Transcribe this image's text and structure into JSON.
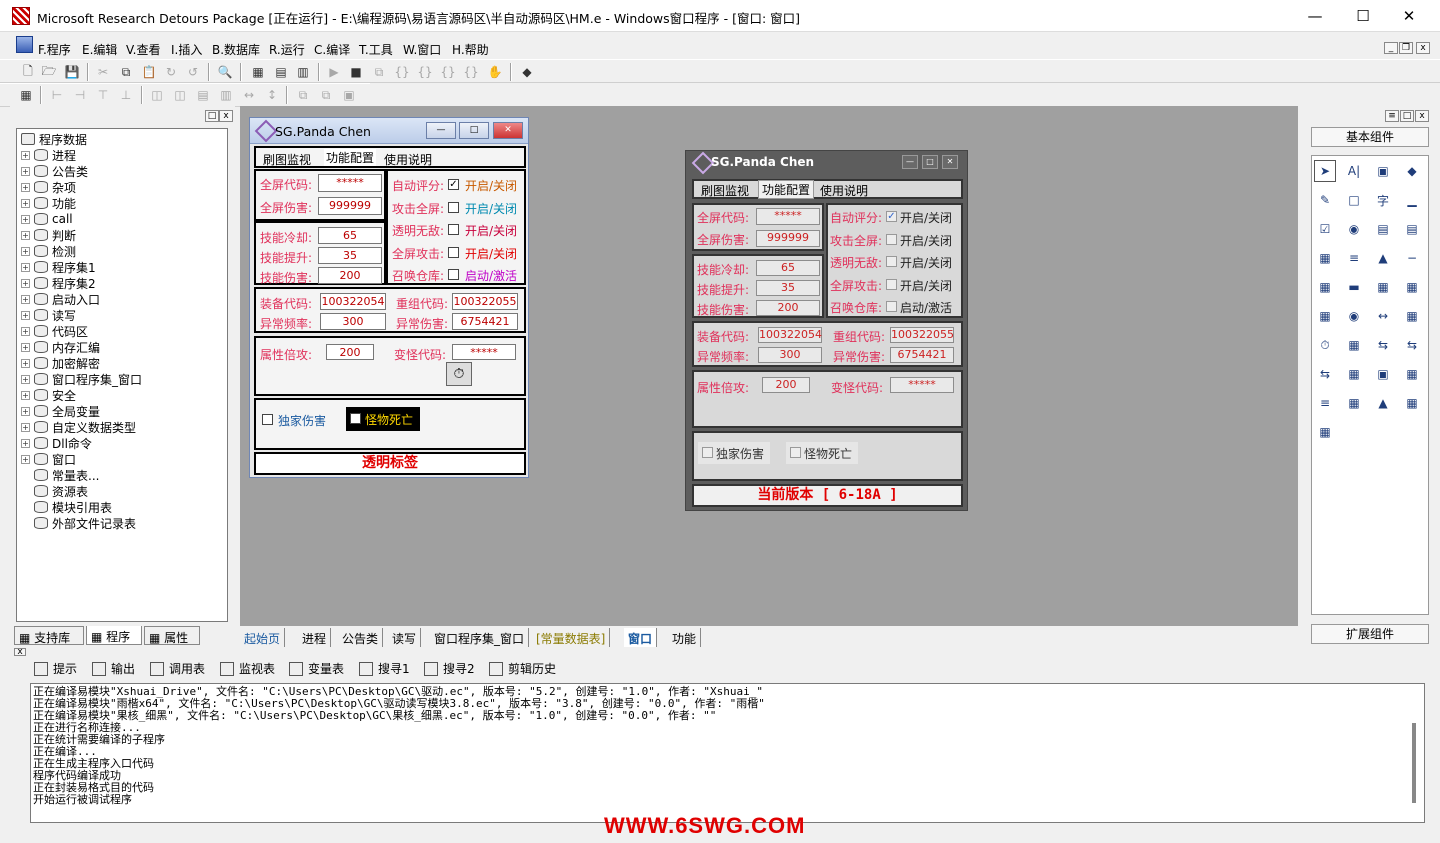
{
  "window": {
    "title": "Microsoft Research Detours Package [正在运行] - E:\\编程源码\\易语言源码区\\半自动源码区\\HM.e - Windows窗口程序 - [窗口: 窗口]"
  },
  "menu": [
    "F.程序",
    "E.编辑",
    "V.查看",
    "I.插入",
    "B.数据库",
    "R.运行",
    "C.编译",
    "T.工具",
    "W.窗口",
    "H.帮助"
  ],
  "tree": {
    "root": "程序数据",
    "items": [
      "进程",
      "公告类",
      "杂项",
      "功能",
      "call",
      "判断",
      "检测",
      "程序集1",
      "程序集2",
      "启动入口",
      "读写",
      "代码区",
      "内存汇编",
      "加密解密",
      "窗口程序集_窗口",
      "安全",
      "全局变量",
      "自定义数据类型",
      "Dll命令",
      "窗口",
      "常量表...",
      "资源表",
      "模块引用表",
      "外部文件记录表"
    ]
  },
  "left_tabs": [
    "支持库",
    "程序",
    "属性"
  ],
  "right_panel": {
    "header": "基本组件",
    "footer": "扩展组件"
  },
  "editor_tabs": [
    "起始页",
    "进程",
    "公告类",
    "读写",
    "窗口程序集_窗口",
    "[常量数据表]",
    "窗口",
    "功能"
  ],
  "output_tabs": [
    "提示",
    "输出",
    "调用表",
    "监视表",
    "变量表",
    "搜寻1",
    "搜寻2",
    "剪辑历史"
  ],
  "output_lines": [
    "正在编译易模块\"Xshuai_Drive\", 文件名: \"C:\\Users\\PC\\Desktop\\GC\\驱动.ec\", 版本号: \"5.2\", 创建号: \"1.0\", 作者: \"Xshuai_\"",
    "正在编译易模块\"雨楷x64\", 文件名: \"C:\\Users\\PC\\Desktop\\GC\\驱动读写模块3.8.ec\", 版本号: \"3.8\", 创建号: \"0.0\", 作者: \"雨楷\"",
    "正在编译易模块\"果核_细黑\", 文件名: \"C:\\Users\\PC\\Desktop\\GC\\果核_细黑.ec\", 版本号: \"1.0\", 创建号: \"0.0\", 作者: \"\"",
    "正在进行名称连接...",
    "正在统计需要编译的子程序",
    "正在编译...",
    "正在生成主程序入口代码",
    "程序代码编译成功",
    "正在封装易格式目的代码",
    "开始运行被调试程序"
  ],
  "watermark": "WWW.6SWG.COM",
  "dialog_design": {
    "title": "SG.Panda Chen",
    "tabs": [
      "刷图监视",
      "功能配置",
      "使用说明"
    ],
    "fields": {
      "fullscreen_code": {
        "label": "全屏代码:",
        "value": "*****"
      },
      "fullscreen_damage": {
        "label": "全屏伤害:",
        "value": "999999"
      },
      "skill_cd": {
        "label": "技能冷却:",
        "value": "65"
      },
      "skill_up": {
        "label": "技能提升:",
        "value": "35"
      },
      "skill_dmg": {
        "label": "技能伤害:",
        "value": "200"
      },
      "equip_code": {
        "label": "装备代码:",
        "value": "100322054"
      },
      "regroup_code": {
        "label": "重组代码:",
        "value": "100322055"
      },
      "abn_freq": {
        "label": "异常频率:",
        "value": "300"
      },
      "abn_dmg": {
        "label": "异常伤害:",
        "value": "6754421"
      },
      "attr_mult": {
        "label": "属性倍攻:",
        "value": "200"
      },
      "monster_code": {
        "label": "变怪代码:",
        "value": "*****"
      }
    },
    "toggles": [
      {
        "label": "自动评分:",
        "text": "开启/关闭",
        "checked": true
      },
      {
        "label": "攻击全屏:",
        "text": "开启/关闭",
        "checked": false
      },
      {
        "label": "透明无敌:",
        "text": "开启/关闭",
        "checked": false
      },
      {
        "label": "全屏攻击:",
        "text": "开启/关闭",
        "checked": false
      },
      {
        "label": "召唤仓库:",
        "text": "启动/激活",
        "checked": false
      }
    ],
    "exclusive_damage": "独家伤害",
    "monster_death": "怪物死亡",
    "footer_label": "透明标签"
  },
  "dialog_running": {
    "title": "SG.Panda Chen",
    "tabs": [
      "刷图监视",
      "功能配置",
      "使用说明"
    ],
    "toggles": [
      {
        "label": "自动评分:",
        "text": "开启/关闭",
        "checked": true
      },
      {
        "label": "攻击全屏:",
        "text": "开启/关闭",
        "checked": false
      },
      {
        "label": "透明无敌:",
        "text": "开启/关闭",
        "checked": false
      },
      {
        "label": "全屏攻击:",
        "text": "开启/关闭",
        "checked": false
      },
      {
        "label": "召唤仓库:",
        "text": "启动/激活",
        "checked": false
      }
    ],
    "footer_label": "当前版本 [ 6-18A ]"
  }
}
